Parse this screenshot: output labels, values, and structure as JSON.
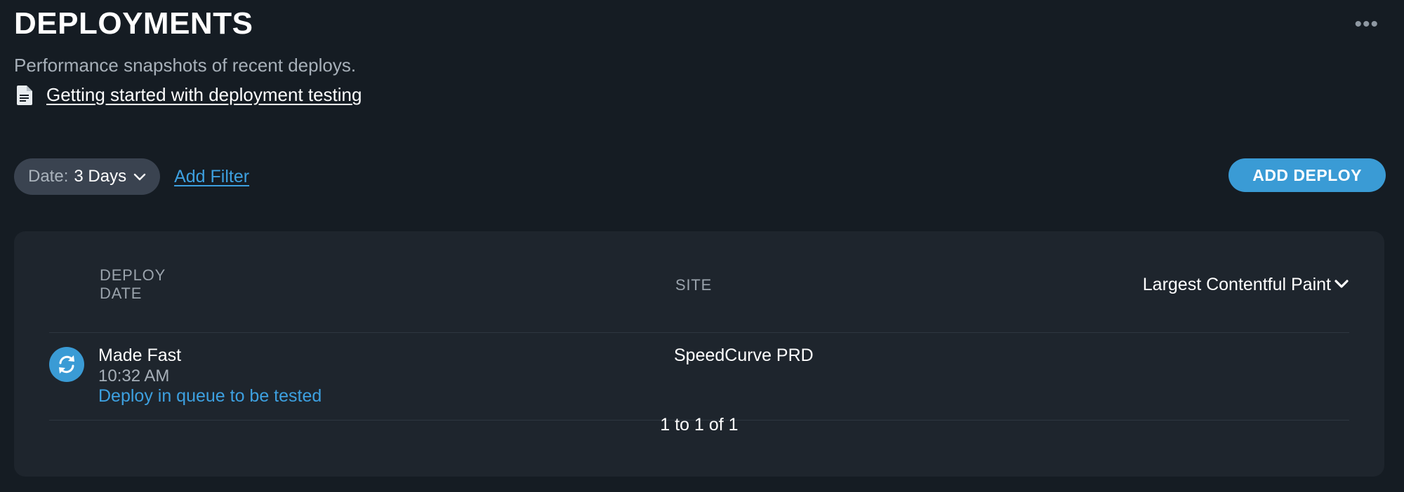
{
  "header": {
    "title": "DEPLOYMENTS",
    "subtitle": "Performance snapshots of recent deploys.",
    "doc_link": "Getting started with deployment testing",
    "more_icon": "more-horizontal-icon"
  },
  "filters": {
    "date_label": "Date:",
    "date_value": "3 Days",
    "add_filter": "Add Filter"
  },
  "actions": {
    "add_deploy": "ADD DEPLOY"
  },
  "table": {
    "columns": {
      "deploy_date_line1": "DEPLOY",
      "deploy_date_line2": "DATE",
      "site": "SITE",
      "metric": "Largest Contentful Paint"
    },
    "rows": [
      {
        "name": "Made Fast",
        "time": "10:32 AM",
        "status": "Deploy in queue to be tested",
        "site": "SpeedCurve PRD",
        "icon": "refresh-icon"
      }
    ],
    "pagination": "1 to 1 of 1"
  },
  "colors": {
    "background": "#151c23",
    "panel": "#1e252d",
    "accent": "#3a9bd5",
    "link": "#3da0e0"
  }
}
